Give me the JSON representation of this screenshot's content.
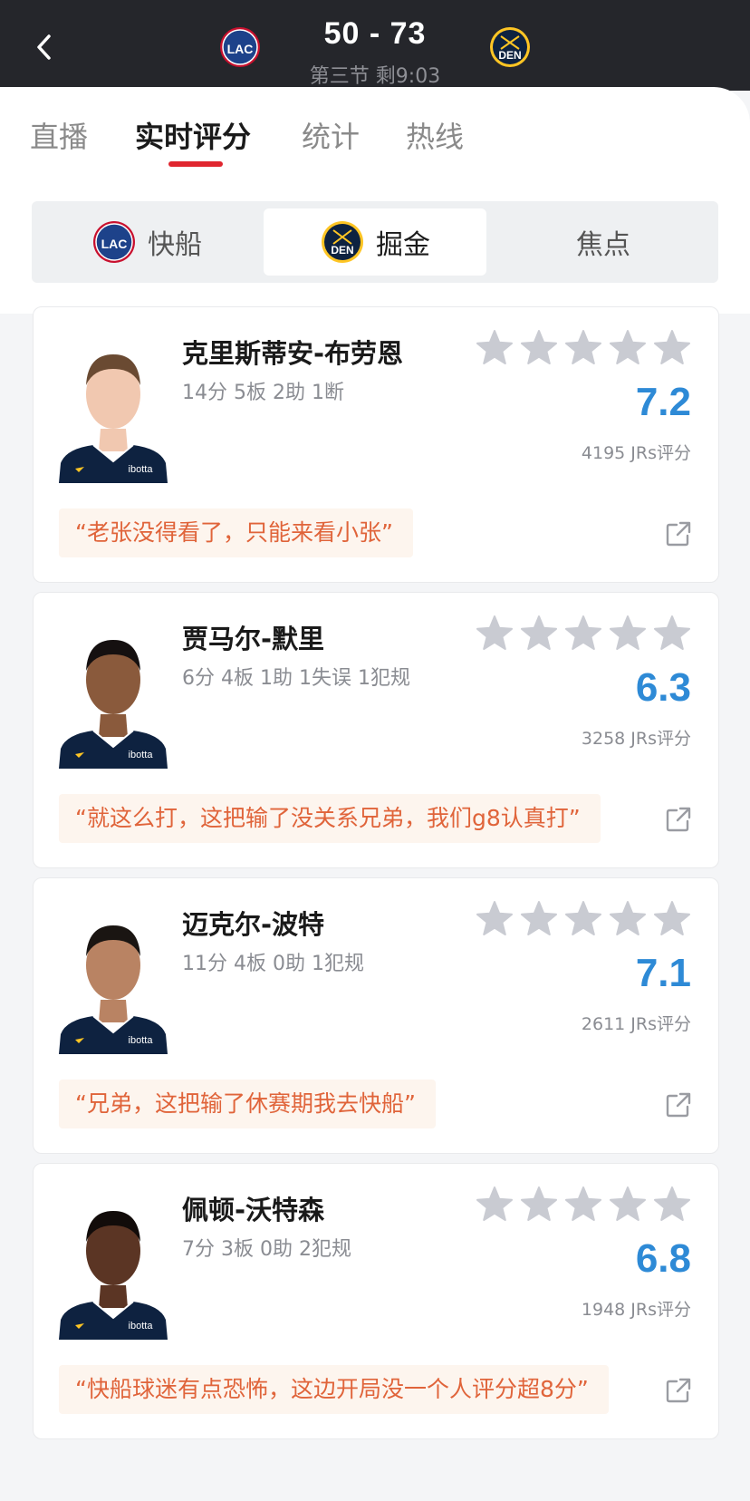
{
  "header": {
    "back_icon": "chevron-left-icon",
    "home_team_logo_text": "LAC",
    "away_team_logo_text": "DEN",
    "score": "50 - 73",
    "period": "第三节 剩9:03"
  },
  "tabs": [
    {
      "label": "直播",
      "active": false
    },
    {
      "label": "实时评分",
      "active": true
    },
    {
      "label": "统计",
      "active": false
    },
    {
      "label": "热线",
      "active": false
    }
  ],
  "segment": [
    {
      "label": "快船",
      "active": false,
      "logo": "LAC"
    },
    {
      "label": "掘金",
      "active": true,
      "logo": "DEN"
    },
    {
      "label": "焦点",
      "active": false
    }
  ],
  "players": [
    {
      "name": "克里斯蒂安-布劳恩",
      "stats": "14分 5板 2助 1断",
      "rating": "7.2",
      "votes": "4195 JRs评分",
      "quote": "“老张没得看了，只能来看小张”",
      "jersey": "ibotta"
    },
    {
      "name": "贾马尔-默里",
      "stats": "6分 4板 1助 1失误 1犯规",
      "rating": "6.3",
      "votes": "3258 JRs评分",
      "quote": "“就这么打，这把输了没关系兄弟，我们g8认真打”",
      "jersey": "ibotta"
    },
    {
      "name": "迈克尔-波特",
      "stats": "11分 4板 0助 1犯规",
      "rating": "7.1",
      "votes": "2611 JRs评分",
      "quote": "“兄弟，这把输了休赛期我去快船”",
      "jersey": "ibotta"
    },
    {
      "name": "佩顿-沃特森",
      "stats": "7分 3板 0助 2犯规",
      "rating": "6.8",
      "votes": "1948 JRs评分",
      "quote": "“快船球迷有点恐怖，这边开局没一个人评分超8分”",
      "jersey": "ibotta"
    }
  ],
  "colors": {
    "header_bg": "#25262b",
    "tab_accent": "#e0262f",
    "rating": "#2e8ad6",
    "quote_text": "#e0643a",
    "quote_bg": "#fdf5ee",
    "star": "#c9cbd2"
  }
}
